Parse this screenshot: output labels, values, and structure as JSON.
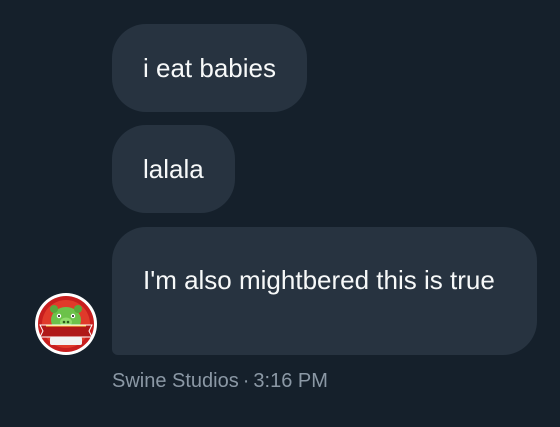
{
  "messages": [
    {
      "text": "i eat babies"
    },
    {
      "text": "lalala"
    },
    {
      "text": "I'm also mightbered this is true"
    }
  ],
  "sender": {
    "name": "Swine Studios",
    "avatar_label": "SWINE STUDIOS",
    "avatar_icon": "pig-logo-icon"
  },
  "timestamp": "3:16 PM",
  "separator": "·",
  "colors": {
    "background": "#15202b",
    "bubble": "#273340",
    "text": "#f7f9f9",
    "meta_text": "#8b98a5"
  }
}
